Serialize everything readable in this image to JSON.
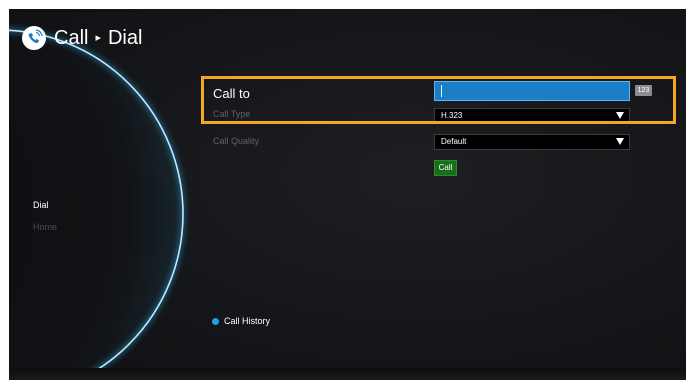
{
  "header": {
    "title": "Call",
    "separator": "▸",
    "subtitle": "Dial",
    "icon": "phone-call-icon"
  },
  "nav": {
    "items": [
      {
        "label": "Dial",
        "active": true
      },
      {
        "label": "Home",
        "active": false
      }
    ]
  },
  "form": {
    "call_to": {
      "label": "Call to",
      "value": "",
      "keyboard_mode": "123"
    },
    "call_type": {
      "label": "Call Type",
      "value": "H.323"
    },
    "call_quality": {
      "label": "Call Quality",
      "value": "Default"
    },
    "call_button": "Call"
  },
  "footer": {
    "history_label": "Call History"
  },
  "colors": {
    "accent": "#1a7fc7",
    "highlight": "#f5a623",
    "call_button": "#1b6d1e",
    "history_dot": "#1aa3e8"
  }
}
